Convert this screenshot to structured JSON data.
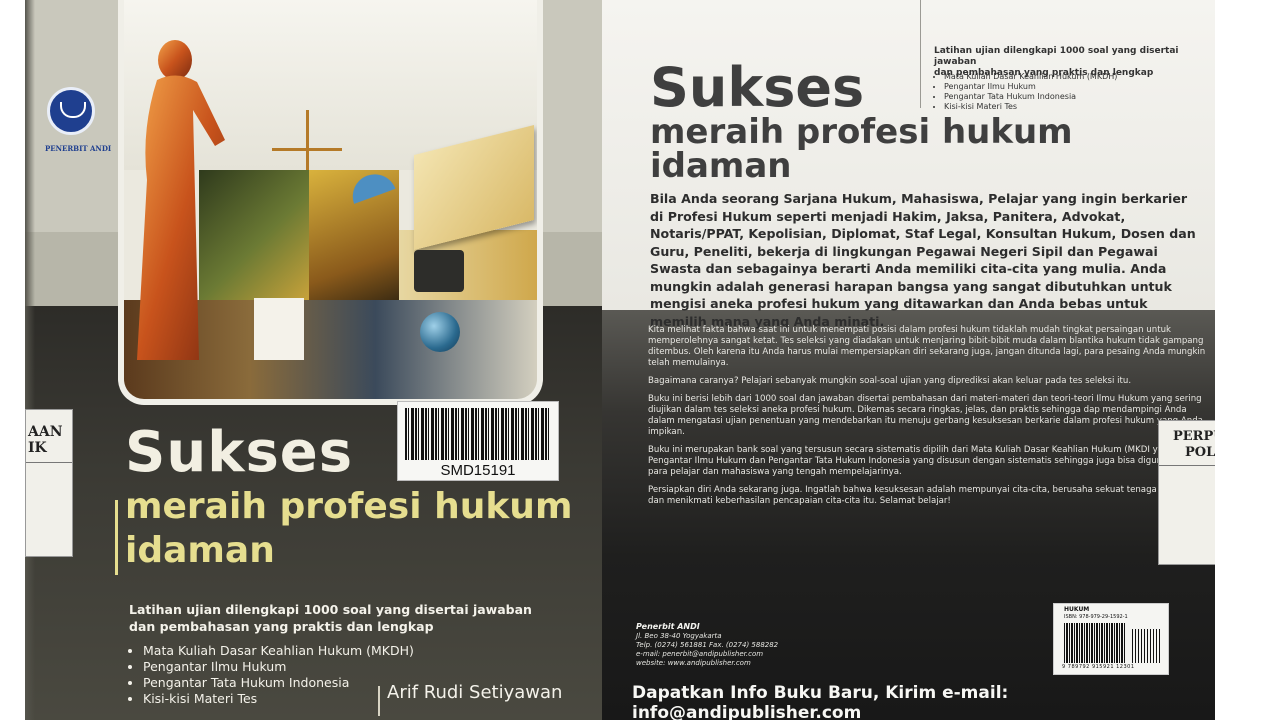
{
  "front": {
    "publisher_logo_text": "PENERBIT ANDI",
    "barcode_label": "SMD15191",
    "library_tag": [
      "AAN",
      "IK"
    ],
    "title": "Sukses",
    "subtitle_line1": "meraih profesi hukum",
    "subtitle_line2": "idaman",
    "description_line1": "Latihan ujian dilengkapi 1000 soal yang disertai jawaban",
    "description_line2": "dan pembahasan yang praktis dan lengkap",
    "topics": [
      "Mata Kuliah Dasar Keahlian Hukum (MKDH)",
      "Pengantar Ilmu Hukum",
      "Pengantar Tata Hukum Indonesia",
      "Kisi-kisi Materi Tes"
    ],
    "author": "Arif Rudi Setiyawan"
  },
  "back": {
    "intro_line1": "Latihan ujian dilengkapi 1000 soal yang disertai jawaban",
    "intro_line2": "dan pembahasan yang praktis dan lengkap",
    "topics": [
      "Mata Kuliah Dasar Keahlian Hukum (MKDH)",
      "Pengantar Ilmu Hukum",
      "Pengantar Tata Hukum Indonesia",
      "Kisi-kisi Materi Tes"
    ],
    "title": "Sukses",
    "subtitle_line1": "meraih profesi hukum",
    "subtitle_line2": "idaman",
    "lead": "Bila Anda seorang Sarjana Hukum, Mahasiswa, Pelajar yang ingin berkarier di Profesi Hukum seperti menjadi Hakim, Jaksa, Panitera, Advokat, Notaris/PPAT, Kepolisian, Diplomat, Staf Legal, Konsultan Hukum, Dosen dan Guru, Peneliti, bekerja di lingkungan Pegawai Negeri Sipil dan Pegawai Swasta dan sebagainya berarti Anda memiliki cita-cita yang mulia. Anda mungkin adalah generasi harapan bangsa yang sangat dibutuhkan untuk mengisi aneka profesi hukum yang ditawarkan dan Anda bebas untuk memilih mana yang Anda minati.",
    "body": [
      "Kita melihat fakta bahwa saat ini untuk menempati posisi dalam profesi hukum tidaklah mudah tingkat persaingan untuk memperolehnya sangat ketat. Tes seleksi yang diadakan untuk menjaring bibit-bibit muda dalam blantika hukum tidak gampang ditembus. Oleh karena itu Anda harus mulai mempersiapkan diri sekarang juga, jangan ditunda lagi, para pesaing Anda mungkin telah memulainya.",
      "Bagaimana caranya? Pelajari sebanyak mungkin soal-soal ujian yang diprediksi akan keluar pada tes seleksi itu.",
      "Buku ini berisi lebih dari 1000 soal dan jawaban disertai pembahasan dari materi-materi dan teori-teori Ilmu Hukum yang sering diujikan dalam tes seleksi aneka profesi hukum. Dikemas secara ringkas, jelas, dan praktis sehingga dap mendampingi Anda dalam mengatasi ujian penentuan yang mendebarkan itu menuju gerbang kesuksesan berkarie dalam profesi hukum yang Anda impikan.",
      "Buku ini merupakan bank soal yang tersusun secara sistematis dipilih dari Mata Kuliah Dasar Keahlian Hukum (MKDI yaitu Pengantar Ilmu Hukum dan Pengantar Tata Hukum Indonesia yang disusun dengan sistematis sehingga juga bisa digunakan oleh para pelajar dan mahasiswa yang tengah mempelajarinya.",
      "Persiapkan diri Anda sekarang juga. Ingatlah bahwa kesuksesan adalah mempunyai cita-cita, berusaha sekuat tenaga meraihnya dan menikmati keberhasilan pencapaian cita-cita itu. Selamat belajar!"
    ],
    "library_tag": [
      "PERPU",
      "POL"
    ],
    "publisher": {
      "name": "Penerbit ANDI",
      "address": "Jl. Beo 38-40 Yogyakarta",
      "phone": "Telp. (0274) 561881 Fax. (0274) 588282",
      "email": "e-mail: penerbit@andipublisher.com",
      "website": "website: www.andipublisher.com"
    },
    "isbn": {
      "category": "HUKUM",
      "code": "ISBN: 978-979-29-1592-1",
      "digits": "9 789792 915921  12301"
    },
    "cta": "Dapatkan Info Buku Baru, Kirim e-mail: info@andipublisher.com"
  }
}
